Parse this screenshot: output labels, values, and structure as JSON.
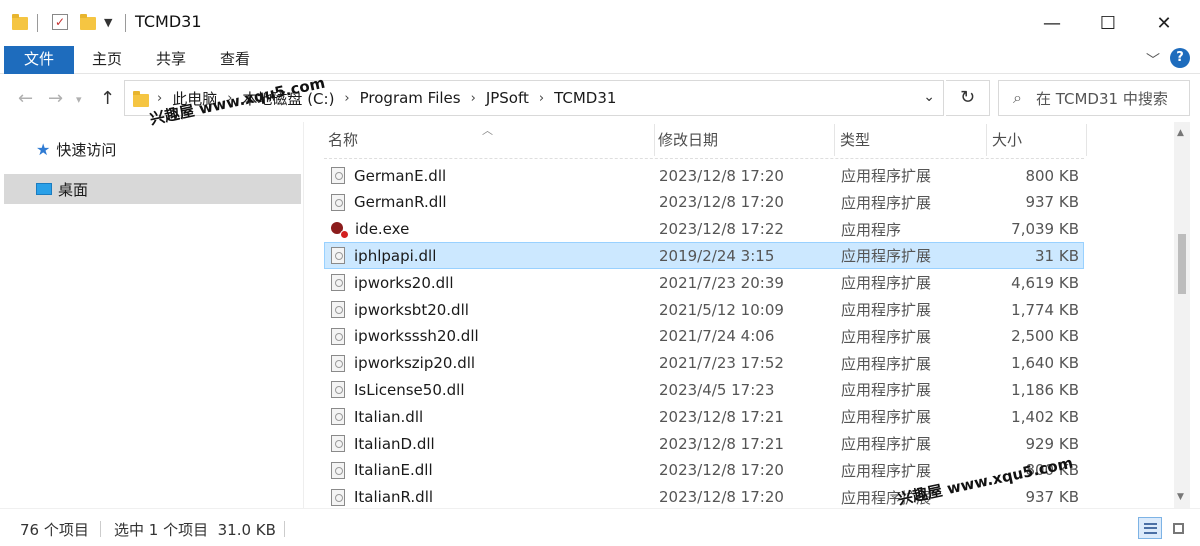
{
  "window": {
    "title": "TCMD31",
    "minimize": "—",
    "maximize": "☐",
    "close": "✕"
  },
  "ribbon": {
    "tabs": [
      "文件",
      "主页",
      "共享",
      "查看"
    ],
    "expand_icon": "chevron-down-icon",
    "help_icon": "help-icon",
    "help_label": "?"
  },
  "address": {
    "crumbs": [
      "此电脑",
      "本地磁盘 (C:)",
      "Program Files",
      "JPSoft",
      "TCMD31"
    ],
    "search_placeholder": "在 TCMD31 中搜索"
  },
  "sidebar": {
    "items": [
      {
        "label": "快速访问",
        "icon": "star-icon"
      },
      {
        "label": "桌面",
        "icon": "desktop-icon"
      }
    ]
  },
  "columns": {
    "name": "名称",
    "date": "修改日期",
    "type": "类型",
    "size": "大小"
  },
  "files": [
    {
      "name": "GermanE.dll",
      "date": "2023/12/8 17:20",
      "type": "应用程序扩展",
      "size": "800 KB",
      "icon": "dll"
    },
    {
      "name": "GermanR.dll",
      "date": "2023/12/8 17:20",
      "type": "应用程序扩展",
      "size": "937 KB",
      "icon": "dll"
    },
    {
      "name": "ide.exe",
      "date": "2023/12/8 17:22",
      "type": "应用程序",
      "size": "7,039 KB",
      "icon": "exe"
    },
    {
      "name": "iphlpapi.dll",
      "date": "2019/2/24 3:15",
      "type": "应用程序扩展",
      "size": "31 KB",
      "icon": "dll",
      "selected": true
    },
    {
      "name": "ipworks20.dll",
      "date": "2021/7/23 20:39",
      "type": "应用程序扩展",
      "size": "4,619 KB",
      "icon": "dll"
    },
    {
      "name": "ipworksbt20.dll",
      "date": "2021/5/12 10:09",
      "type": "应用程序扩展",
      "size": "1,774 KB",
      "icon": "dll"
    },
    {
      "name": "ipworksssh20.dll",
      "date": "2021/7/24 4:06",
      "type": "应用程序扩展",
      "size": "2,500 KB",
      "icon": "dll"
    },
    {
      "name": "ipworkszip20.dll",
      "date": "2021/7/23 17:52",
      "type": "应用程序扩展",
      "size": "1,640 KB",
      "icon": "dll"
    },
    {
      "name": "IsLicense50.dll",
      "date": "2023/4/5 17:23",
      "type": "应用程序扩展",
      "size": "1,186 KB",
      "icon": "dll"
    },
    {
      "name": "Italian.dll",
      "date": "2023/12/8 17:21",
      "type": "应用程序扩展",
      "size": "1,402 KB",
      "icon": "dll"
    },
    {
      "name": "ItalianD.dll",
      "date": "2023/12/8 17:21",
      "type": "应用程序扩展",
      "size": "929 KB",
      "icon": "dll"
    },
    {
      "name": "ItalianE.dll",
      "date": "2023/12/8 17:20",
      "type": "应用程序扩展",
      "size": "800 KB",
      "icon": "dll"
    },
    {
      "name": "ItalianR.dll",
      "date": "2023/12/8 17:20",
      "type": "应用程序扩展",
      "size": "937 KB",
      "icon": "dll"
    }
  ],
  "status": {
    "count": "76 个项目",
    "selection": "选中 1 个项目  31.0 KB"
  },
  "watermark": {
    "text": "兴趣屋 www.xqu5.com"
  },
  "colors": {
    "file_tab": "#1e6cbd",
    "selected_row": "#cce8ff",
    "selected_border": "#99d1ff"
  }
}
